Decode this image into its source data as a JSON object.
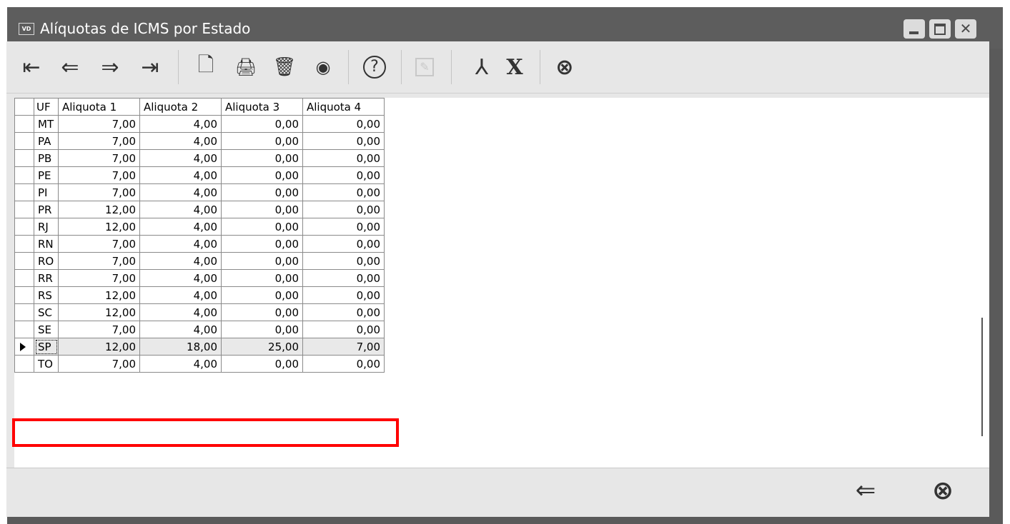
{
  "window": {
    "icon_text": "VD",
    "title": "Alíquotas de ICMS por Estado",
    "title_bg": "#5d5d5d"
  },
  "toolbar": {
    "first": "⇤",
    "prev": "⇐",
    "next": "⇒",
    "last": "⇥",
    "new": "🗋",
    "print": "🖨",
    "delete": "🗑",
    "view": "◉",
    "help": "?",
    "edit": "✎",
    "pdf": "⅄",
    "excel": "X",
    "close": "⊗"
  },
  "grid": {
    "columns": [
      "UF",
      "Aliquota 1",
      "Aliquota 2",
      "Aliquota 3",
      "Aliquota 4"
    ],
    "rows": [
      {
        "uf": "MT",
        "a1": "7,00",
        "a2": "4,00",
        "a3": "0,00",
        "a4": "0,00"
      },
      {
        "uf": "PA",
        "a1": "7,00",
        "a2": "4,00",
        "a3": "0,00",
        "a4": "0,00"
      },
      {
        "uf": "PB",
        "a1": "7,00",
        "a2": "4,00",
        "a3": "0,00",
        "a4": "0,00"
      },
      {
        "uf": "PE",
        "a1": "7,00",
        "a2": "4,00",
        "a3": "0,00",
        "a4": "0,00"
      },
      {
        "uf": "PI",
        "a1": "7,00",
        "a2": "4,00",
        "a3": "0,00",
        "a4": "0,00"
      },
      {
        "uf": "PR",
        "a1": "12,00",
        "a2": "4,00",
        "a3": "0,00",
        "a4": "0,00"
      },
      {
        "uf": "RJ",
        "a1": "12,00",
        "a2": "4,00",
        "a3": "0,00",
        "a4": "0,00"
      },
      {
        "uf": "RN",
        "a1": "7,00",
        "a2": "4,00",
        "a3": "0,00",
        "a4": "0,00"
      },
      {
        "uf": "RO",
        "a1": "7,00",
        "a2": "4,00",
        "a3": "0,00",
        "a4": "0,00"
      },
      {
        "uf": "RR",
        "a1": "7,00",
        "a2": "4,00",
        "a3": "0,00",
        "a4": "0,00"
      },
      {
        "uf": "RS",
        "a1": "12,00",
        "a2": "4,00",
        "a3": "0,00",
        "a4": "0,00"
      },
      {
        "uf": "SC",
        "a1": "12,00",
        "a2": "4,00",
        "a3": "0,00",
        "a4": "0,00"
      },
      {
        "uf": "SE",
        "a1": "7,00",
        "a2": "4,00",
        "a3": "0,00",
        "a4": "0,00"
      },
      {
        "uf": "SP",
        "a1": "12,00",
        "a2": "18,00",
        "a3": "25,00",
        "a4": "7,00",
        "selected": true
      },
      {
        "uf": "TO",
        "a1": "7,00",
        "a2": "4,00",
        "a3": "0,00",
        "a4": "0,00"
      }
    ],
    "highlight_color": "#ff0000"
  },
  "footer": {
    "back": "⇐",
    "close": "⊗"
  }
}
